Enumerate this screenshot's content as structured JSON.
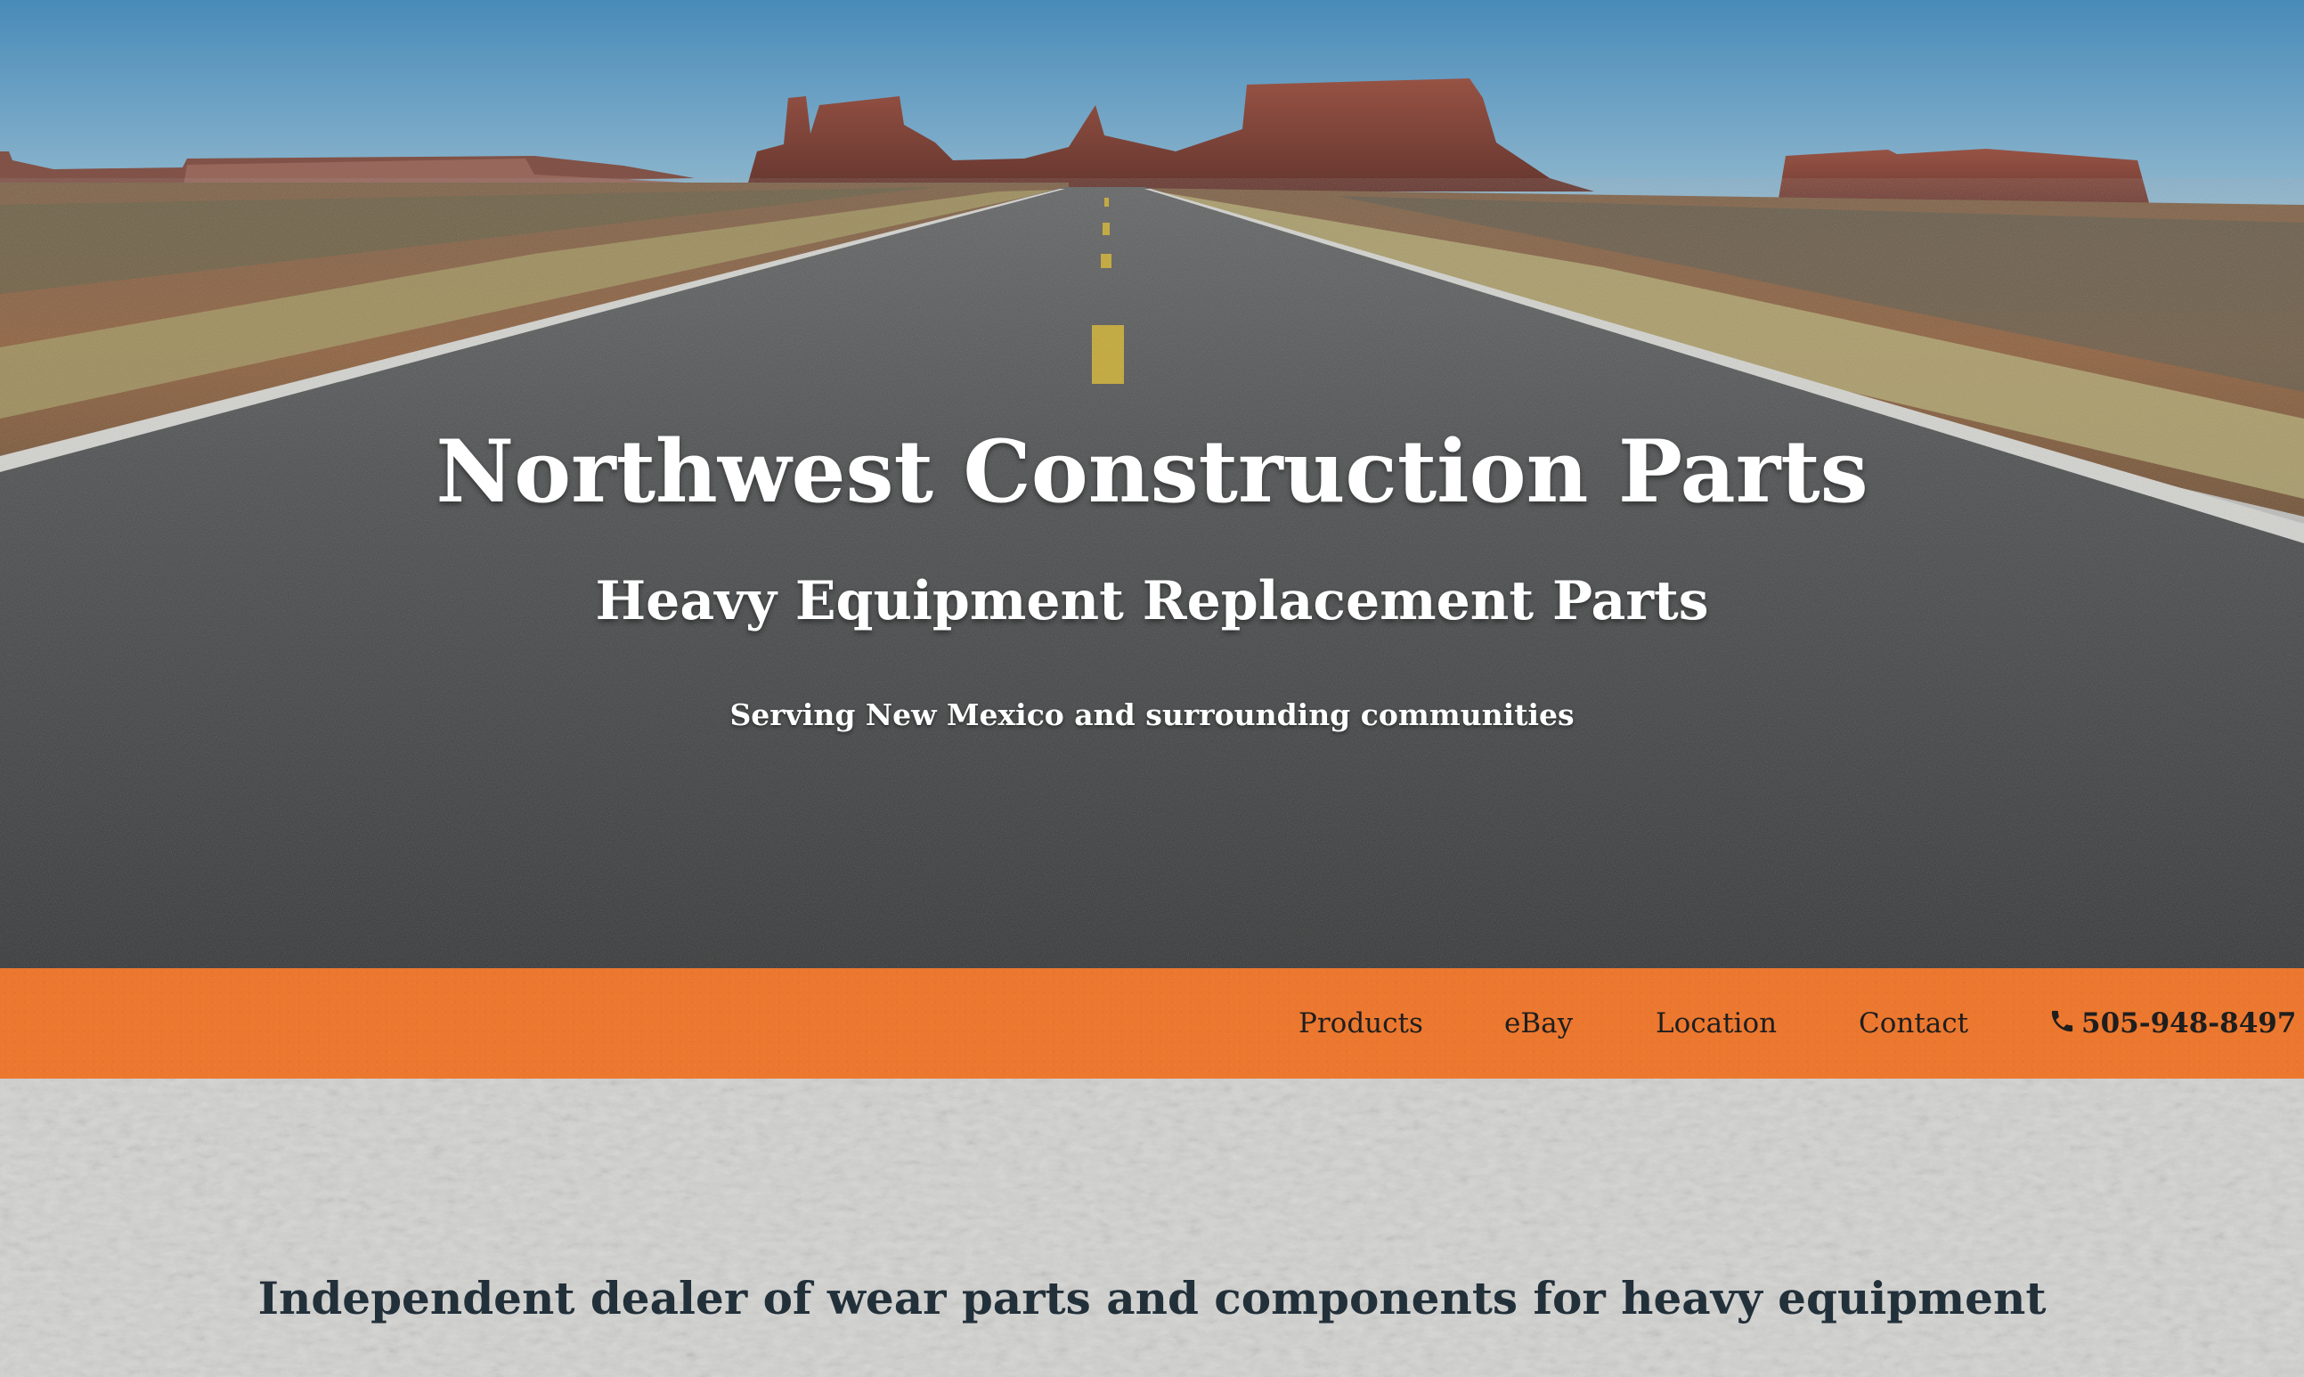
{
  "hero": {
    "title": "Northwest Construction Parts",
    "tagline": "Heavy Equipment Replacement Parts",
    "service_area": "Serving New Mexico and surrounding communities"
  },
  "nav": {
    "items": [
      {
        "label": "Products"
      },
      {
        "label": "eBay"
      },
      {
        "label": "Location"
      },
      {
        "label": "Contact"
      }
    ],
    "phone": {
      "label": "505-948-8497",
      "icon": "phone-icon"
    }
  },
  "intro": {
    "heading": "Independent dealer of wear parts and components for heavy equipment"
  },
  "colors": {
    "nav_bar": "#ec772e",
    "nav_text": "#1e1e1e",
    "hero_text": "#ffffff",
    "intro_text": "#22303a"
  }
}
